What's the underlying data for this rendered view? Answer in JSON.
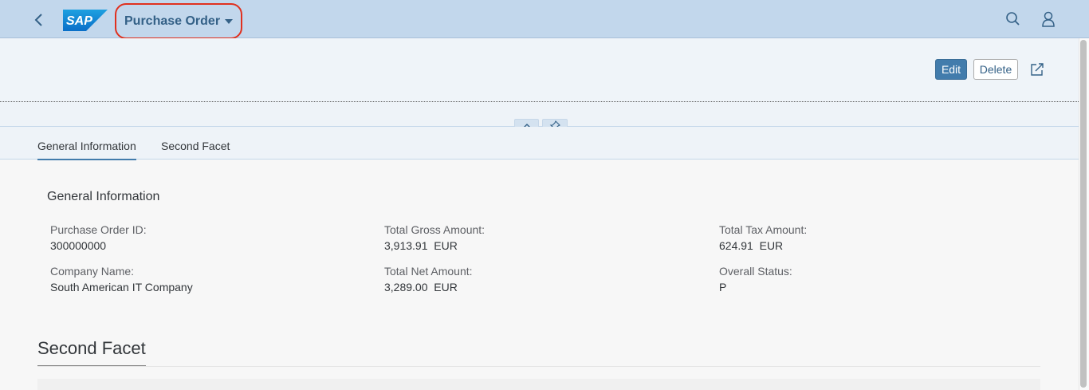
{
  "shell": {
    "title": "Purchase Order",
    "logo": "SAP",
    "icons": [
      "back-icon",
      "search-icon",
      "user-icon"
    ]
  },
  "actions": {
    "edit_label": "Edit",
    "delete_label": "Delete"
  },
  "tabs": [
    {
      "label": "General Information",
      "active": true
    },
    {
      "label": "Second Facet",
      "active": false
    }
  ],
  "general": {
    "title": "General Information",
    "fields": {
      "po_id": {
        "label": "Purchase Order ID:",
        "value": "300000000"
      },
      "company": {
        "label": "Company Name:",
        "value": "South American IT Company"
      },
      "gross": {
        "label": "Total Gross Amount:",
        "value": "3,913.91  EUR"
      },
      "net": {
        "label": "Total Net Amount:",
        "value": "3,289.00  EUR"
      },
      "tax": {
        "label": "Total Tax Amount:",
        "value": "624.91  EUR"
      },
      "status": {
        "label": "Overall Status:",
        "value": "P"
      }
    }
  },
  "second_facet": {
    "title": "Second Facet"
  },
  "colors": {
    "shell_bg": "#c2d7ec",
    "accent": "#427cac",
    "highlight": "#e0301e"
  }
}
